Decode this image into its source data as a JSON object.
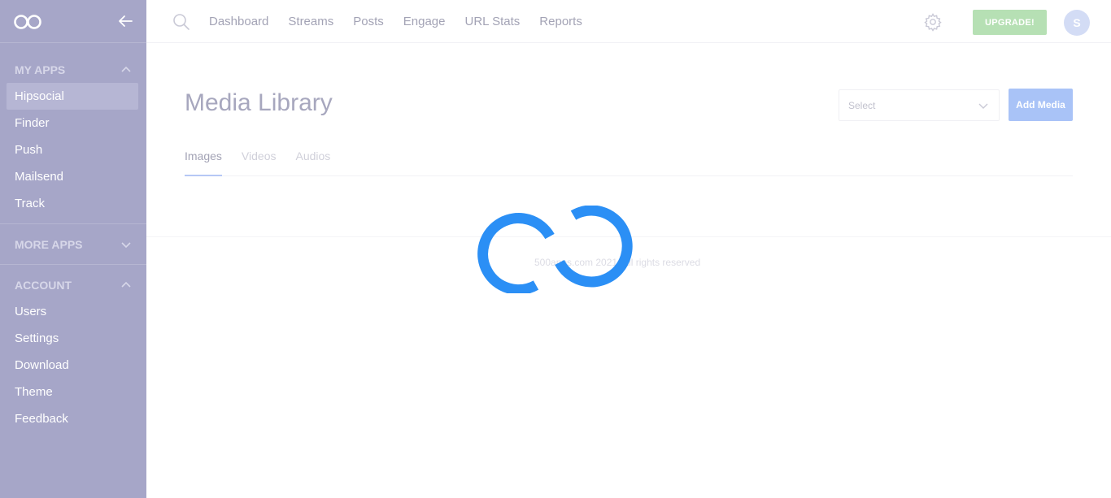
{
  "sidebar": {
    "sections": [
      {
        "title": "MY APPS",
        "items": [
          "Hipsocial",
          "Finder",
          "Push",
          "Mailsend",
          "Track"
        ],
        "active": "Hipsocial"
      },
      {
        "title": "MORE APPS",
        "items": []
      },
      {
        "title": "ACCOUNT",
        "items": [
          "Users",
          "Settings",
          "Download",
          "Theme",
          "Feedback"
        ]
      }
    ]
  },
  "topnav": {
    "items": [
      "Dashboard",
      "Streams",
      "Posts",
      "Engage",
      "URL Stats",
      "Reports"
    ],
    "upgrade_label": "UPGRADE!",
    "avatar_initial": "S"
  },
  "main": {
    "title": "Media Library",
    "select_placeholder": "Select",
    "add_media_label": "Add Media",
    "tabs": [
      "Images",
      "Videos",
      "Audios"
    ],
    "active_tab": "Images"
  },
  "footer": {
    "text": "500apps.com 2021. All rights reserved"
  },
  "colors": {
    "sidebar_bg": "#a6a6c8",
    "spinner": "#2b8ff5",
    "upgrade": "#b6e0b4",
    "add_media": "#a9c3f7"
  },
  "icons": [
    "infinity-logo-icon",
    "arrow-left-icon",
    "chevron-up-icon",
    "chevron-down-icon",
    "search-icon",
    "gear-icon",
    "infinity-spinner-icon"
  ]
}
